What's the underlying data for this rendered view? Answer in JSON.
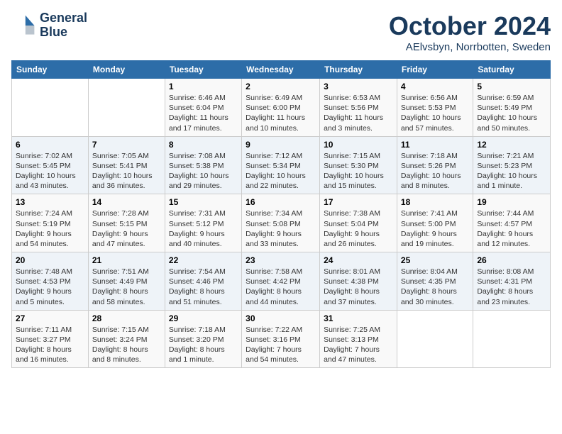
{
  "header": {
    "logo_line1": "General",
    "logo_line2": "Blue",
    "month": "October 2024",
    "location": "AElvsbyn, Norrbotten, Sweden"
  },
  "weekdays": [
    "Sunday",
    "Monday",
    "Tuesday",
    "Wednesday",
    "Thursday",
    "Friday",
    "Saturday"
  ],
  "weeks": [
    [
      {
        "day": "",
        "info": ""
      },
      {
        "day": "",
        "info": ""
      },
      {
        "day": "1",
        "info": "Sunrise: 6:46 AM\nSunset: 6:04 PM\nDaylight: 11 hours and 17 minutes."
      },
      {
        "day": "2",
        "info": "Sunrise: 6:49 AM\nSunset: 6:00 PM\nDaylight: 11 hours and 10 minutes."
      },
      {
        "day": "3",
        "info": "Sunrise: 6:53 AM\nSunset: 5:56 PM\nDaylight: 11 hours and 3 minutes."
      },
      {
        "day": "4",
        "info": "Sunrise: 6:56 AM\nSunset: 5:53 PM\nDaylight: 10 hours and 57 minutes."
      },
      {
        "day": "5",
        "info": "Sunrise: 6:59 AM\nSunset: 5:49 PM\nDaylight: 10 hours and 50 minutes."
      }
    ],
    [
      {
        "day": "6",
        "info": "Sunrise: 7:02 AM\nSunset: 5:45 PM\nDaylight: 10 hours and 43 minutes."
      },
      {
        "day": "7",
        "info": "Sunrise: 7:05 AM\nSunset: 5:41 PM\nDaylight: 10 hours and 36 minutes."
      },
      {
        "day": "8",
        "info": "Sunrise: 7:08 AM\nSunset: 5:38 PM\nDaylight: 10 hours and 29 minutes."
      },
      {
        "day": "9",
        "info": "Sunrise: 7:12 AM\nSunset: 5:34 PM\nDaylight: 10 hours and 22 minutes."
      },
      {
        "day": "10",
        "info": "Sunrise: 7:15 AM\nSunset: 5:30 PM\nDaylight: 10 hours and 15 minutes."
      },
      {
        "day": "11",
        "info": "Sunrise: 7:18 AM\nSunset: 5:26 PM\nDaylight: 10 hours and 8 minutes."
      },
      {
        "day": "12",
        "info": "Sunrise: 7:21 AM\nSunset: 5:23 PM\nDaylight: 10 hours and 1 minute."
      }
    ],
    [
      {
        "day": "13",
        "info": "Sunrise: 7:24 AM\nSunset: 5:19 PM\nDaylight: 9 hours and 54 minutes."
      },
      {
        "day": "14",
        "info": "Sunrise: 7:28 AM\nSunset: 5:15 PM\nDaylight: 9 hours and 47 minutes."
      },
      {
        "day": "15",
        "info": "Sunrise: 7:31 AM\nSunset: 5:12 PM\nDaylight: 9 hours and 40 minutes."
      },
      {
        "day": "16",
        "info": "Sunrise: 7:34 AM\nSunset: 5:08 PM\nDaylight: 9 hours and 33 minutes."
      },
      {
        "day": "17",
        "info": "Sunrise: 7:38 AM\nSunset: 5:04 PM\nDaylight: 9 hours and 26 minutes."
      },
      {
        "day": "18",
        "info": "Sunrise: 7:41 AM\nSunset: 5:00 PM\nDaylight: 9 hours and 19 minutes."
      },
      {
        "day": "19",
        "info": "Sunrise: 7:44 AM\nSunset: 4:57 PM\nDaylight: 9 hours and 12 minutes."
      }
    ],
    [
      {
        "day": "20",
        "info": "Sunrise: 7:48 AM\nSunset: 4:53 PM\nDaylight: 9 hours and 5 minutes."
      },
      {
        "day": "21",
        "info": "Sunrise: 7:51 AM\nSunset: 4:49 PM\nDaylight: 8 hours and 58 minutes."
      },
      {
        "day": "22",
        "info": "Sunrise: 7:54 AM\nSunset: 4:46 PM\nDaylight: 8 hours and 51 minutes."
      },
      {
        "day": "23",
        "info": "Sunrise: 7:58 AM\nSunset: 4:42 PM\nDaylight: 8 hours and 44 minutes."
      },
      {
        "day": "24",
        "info": "Sunrise: 8:01 AM\nSunset: 4:38 PM\nDaylight: 8 hours and 37 minutes."
      },
      {
        "day": "25",
        "info": "Sunrise: 8:04 AM\nSunset: 4:35 PM\nDaylight: 8 hours and 30 minutes."
      },
      {
        "day": "26",
        "info": "Sunrise: 8:08 AM\nSunset: 4:31 PM\nDaylight: 8 hours and 23 minutes."
      }
    ],
    [
      {
        "day": "27",
        "info": "Sunrise: 7:11 AM\nSunset: 3:27 PM\nDaylight: 8 hours and 16 minutes."
      },
      {
        "day": "28",
        "info": "Sunrise: 7:15 AM\nSunset: 3:24 PM\nDaylight: 8 hours and 8 minutes."
      },
      {
        "day": "29",
        "info": "Sunrise: 7:18 AM\nSunset: 3:20 PM\nDaylight: 8 hours and 1 minute."
      },
      {
        "day": "30",
        "info": "Sunrise: 7:22 AM\nSunset: 3:16 PM\nDaylight: 7 hours and 54 minutes."
      },
      {
        "day": "31",
        "info": "Sunrise: 7:25 AM\nSunset: 3:13 PM\nDaylight: 7 hours and 47 minutes."
      },
      {
        "day": "",
        "info": ""
      },
      {
        "day": "",
        "info": ""
      }
    ]
  ]
}
